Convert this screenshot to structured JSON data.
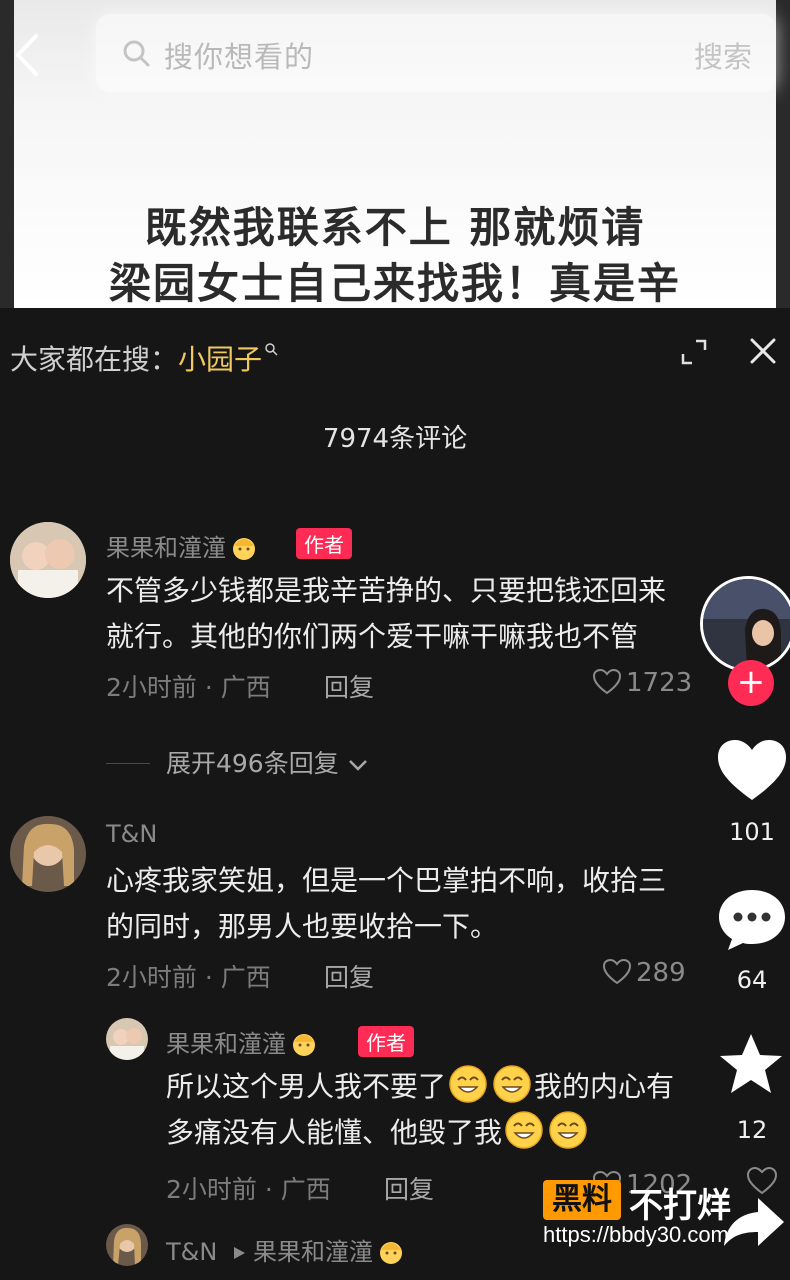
{
  "search": {
    "placeholder": "搜你想看的",
    "submit_label": "搜索"
  },
  "video": {
    "caption_line1": "既然我联系不上 那就烦请",
    "caption_line2": "梁园女士自己来找我！真是辛"
  },
  "trending": {
    "prefix": "大家都在搜：",
    "keyword": "小园子"
  },
  "comments_header": {
    "count_label": "7974条评论"
  },
  "comments": [
    {
      "username": "果果和潼潼",
      "badge": "作者",
      "text_line1": "不管多少钱都是我辛苦挣的、只要把钱还回来",
      "text_line2": "就行。其他的你们两个爱干嘛干嘛我也不管",
      "time_location": "2小时前 · 广西",
      "reply_label": "回复",
      "likes": "1723",
      "expand_label": "展开496条回复"
    },
    {
      "username": "T&N",
      "text_line1": "心疼我家笑姐，但是一个巴掌拍不响，收拾三",
      "text_line2": "的同时，那男人也要收拾一下。",
      "time_location": "2小时前 · 广西",
      "reply_label": "回复",
      "likes": "289"
    }
  ],
  "replies": [
    {
      "username": "果果和潼潼",
      "badge": "作者",
      "text_line1a": "所以这个男人我不要了",
      "text_line1b": "我的内心有",
      "text_line2": "多痛没有人能懂、他毁了我",
      "time_location": "2小时前 · 广西",
      "reply_label": "回复",
      "likes": "1202"
    },
    {
      "username": "T&N",
      "reply_to": "果果和潼潼"
    }
  ],
  "rail": {
    "like_count": "101",
    "comment_count": "64",
    "favorite_count": "12"
  },
  "watermark": {
    "badge": "黑料",
    "title": "不打烊",
    "url": "https://bbdy30.com"
  },
  "colors": {
    "accent": "#fe2c55",
    "keyword": "#f0c860",
    "panel_bg": "#161616"
  }
}
